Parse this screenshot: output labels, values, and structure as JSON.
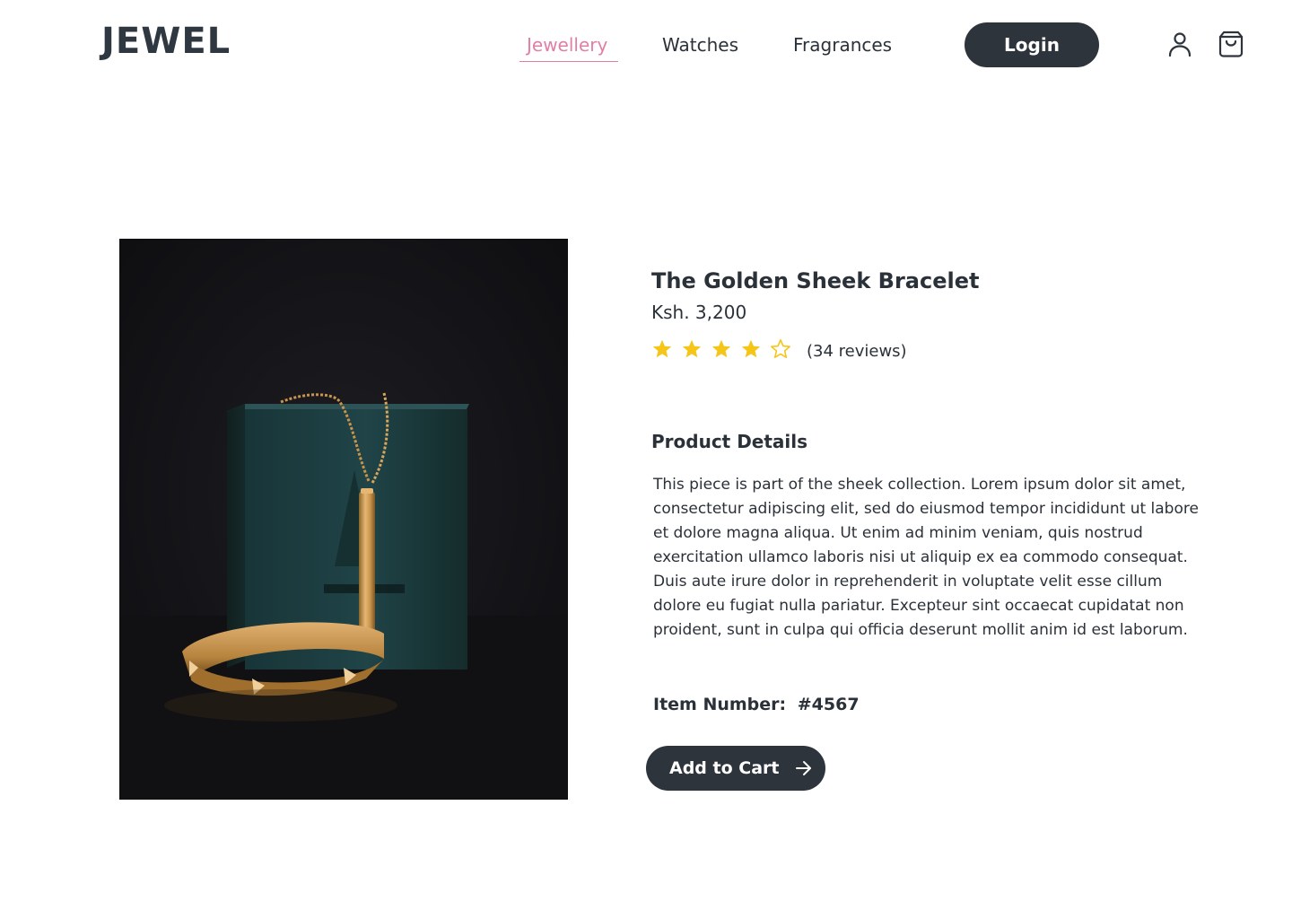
{
  "header": {
    "logo": "JEWEL",
    "nav": [
      {
        "label": "Jewellery",
        "active": true
      },
      {
        "label": "Watches",
        "active": false
      },
      {
        "label": "Fragrances",
        "active": false
      }
    ],
    "login_label": "Login",
    "icons": [
      "user-icon",
      "shopping-bag-icon"
    ]
  },
  "product": {
    "image_icon": "product-photo",
    "title": "The Golden Sheek Bracelet",
    "price": "Ksh. 3,200",
    "rating": 4,
    "rating_max": 5,
    "reviews": "(34 reviews)",
    "details_heading": "Product Details",
    "description": "This piece is part of the sheek collection. Lorem ipsum dolor sit amet, consectetur adipiscing elit, sed do eiusmod tempor incididunt ut labore et dolore magna aliqua. Ut enim ad minim veniam, quis nostrud exercitation ullamco laboris nisi ut aliquip ex ea commodo consequat. Duis aute irure dolor in reprehenderit in voluptate velit esse cillum dolore eu fugiat nulla pariatur. Excepteur sint occaecat cupidatat non proident, sunt in culpa qui officia deserunt mollit anim id est laborum.",
    "item_number_label": "Item Number:",
    "item_number_value": "#4567",
    "add_to_cart_label": "Add to Cart"
  },
  "colors": {
    "accent": "#e07fa6",
    "dark": "#2d343c",
    "star": "#f5c518"
  }
}
